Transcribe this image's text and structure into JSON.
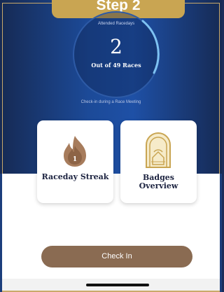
{
  "header": {
    "step_label": "Step 2"
  },
  "progress": {
    "caption": "Attended Racedays",
    "value": "2",
    "subtitle": "Out of 49 Races",
    "completed": 2,
    "total": 49
  },
  "checkin_note": "Check-in during a Race Meeting",
  "cards": {
    "streak": {
      "label": "Raceday Streak",
      "icon": "flame-icon",
      "badge_number": "1"
    },
    "badges": {
      "label_line1": "Badges",
      "label_line2": "Overview",
      "icon": "arch-badge-icon"
    }
  },
  "actions": {
    "checkin_label": "Check In"
  },
  "colors": {
    "accent_gold": "#c9a552",
    "button_brown": "#8a6b52",
    "ring_blue": "#7ec2f2",
    "background_blue": "#1e50a6"
  }
}
